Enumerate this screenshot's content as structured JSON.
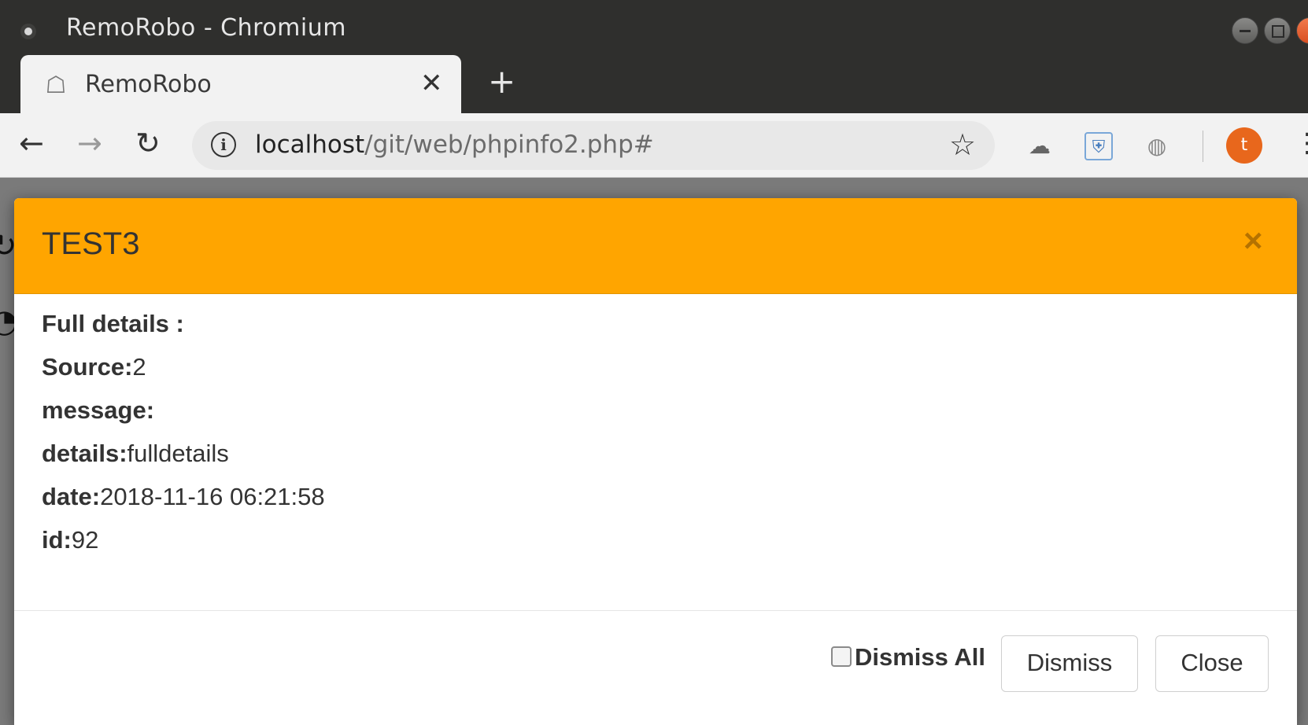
{
  "window": {
    "title": "RemoRobo - Chromium"
  },
  "tab": {
    "title": "RemoRobo",
    "close_glyph": "✕",
    "new_tab_glyph": "+"
  },
  "toolbar": {
    "back_glyph": "←",
    "forward_glyph": "→",
    "reload_glyph": "↻",
    "info_glyph": "i",
    "url_host": "localhost",
    "url_path": "/git/web/phpinfo2.php#",
    "bookmark_glyph": "☆",
    "avatar_letter": "t",
    "menu_glyph": "⋮",
    "extension_icons": [
      "cloud-link-icon",
      "shield-extension-icon",
      "globe-icon"
    ]
  },
  "modal": {
    "title": "TEST3",
    "close_glyph": "×",
    "header_color": "#ffa500",
    "details": [
      {
        "label": "Full details :",
        "value": ""
      },
      {
        "label": "Source:",
        "value": "2"
      },
      {
        "label": "message:",
        "value": ""
      },
      {
        "label": "details:",
        "value": "fulldetails"
      },
      {
        "label": "date:",
        "value": "2018-11-16 06:21:58"
      },
      {
        "label": "id:",
        "value": "92"
      }
    ],
    "dismiss_all_label": "Dismiss All",
    "dismiss_all_checked": false,
    "dismiss_button": "Dismiss",
    "close_button": "Close"
  }
}
